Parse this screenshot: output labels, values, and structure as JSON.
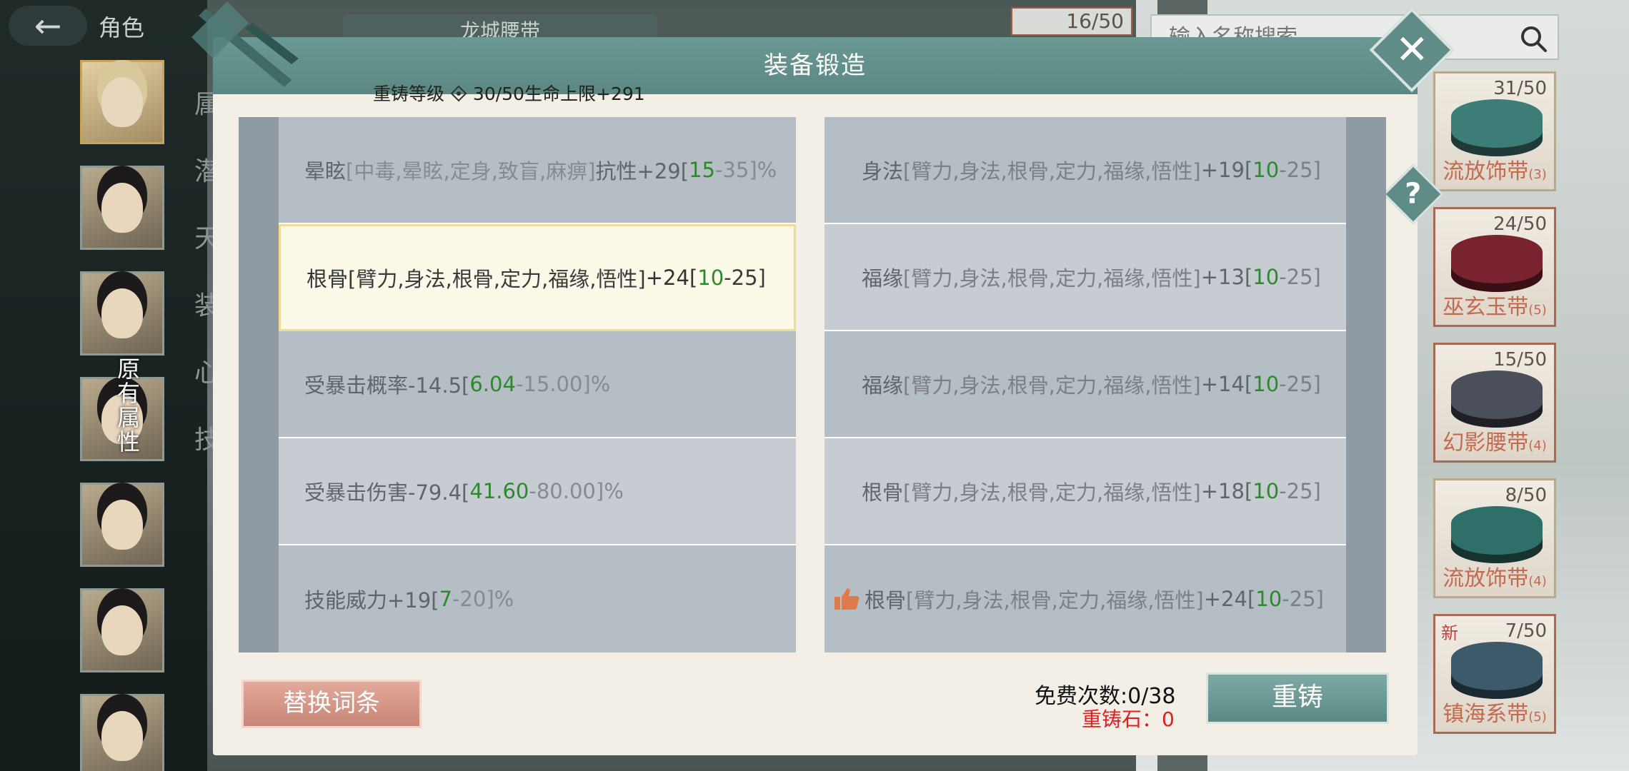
{
  "topbar": {
    "title": "角色",
    "back_icon": "back-arrow-icon"
  },
  "background": {
    "tab_label": "龙城腰带",
    "side_menu": [
      "属",
      "潜",
      "天",
      "装",
      "心",
      "技"
    ],
    "top_count": "16/50",
    "original_attr_label": "原有属性"
  },
  "search": {
    "placeholder": "输入名称搜索"
  },
  "items": [
    {
      "count": "31/50",
      "name": "流放饰带",
      "qty": "(3)",
      "color": "#3d7d78"
    },
    {
      "count": "24/50",
      "name": "巫玄玉带",
      "qty": "(5)",
      "color": "#7a2330"
    },
    {
      "count": "15/50",
      "name": "幻影腰带",
      "qty": "(4)",
      "color": "#4b4f5a"
    },
    {
      "count": "8/50",
      "name": "流放饰带",
      "qty": "(4)",
      "color": "#2f6f6a"
    },
    {
      "count": "7/50",
      "name": "镇海系带",
      "qty": "(5)",
      "color": "#3c5a6a",
      "badge": "新"
    }
  ],
  "modal": {
    "title": "装备锻造",
    "reforge_level": "重铸等级",
    "reforge_level_value": "30/50生命上限+291",
    "left_rows": [
      {
        "name": "晕眩",
        "scope": "[中毒,晕眩,定身,致盲,麻痹]",
        "suffix": "抗性+29[",
        "low": "15",
        "high": "-35]%"
      },
      {
        "name": "根骨",
        "scope": "[臂力,身法,根骨,定力,福缘,悟性]",
        "suffix": "+24[",
        "low": "10",
        "high": "-25]",
        "selected": true
      },
      {
        "name": "受暴击概率-14.5[",
        "scope": "",
        "suffix": "",
        "low": "6.04",
        "high": "-15.00]%"
      },
      {
        "name": "受暴击伤害-79.4[",
        "scope": "",
        "suffix": "",
        "low": "41.60",
        "high": "-80.00]%"
      },
      {
        "name": "技能威力+19[",
        "scope": "",
        "suffix": "",
        "low": "7",
        "high": "-20]%"
      }
    ],
    "right_rows": [
      {
        "name": "身法",
        "scope": "[臂力,身法,根骨,定力,福缘,悟性]",
        "suffix": "+19[",
        "low": "10",
        "high": "-25]"
      },
      {
        "name": "福缘",
        "scope": "[臂力,身法,根骨,定力,福缘,悟性]",
        "suffix": "+13[",
        "low": "10",
        "high": "-25]"
      },
      {
        "name": "福缘",
        "scope": "[臂力,身法,根骨,定力,福缘,悟性]",
        "suffix": "+14[",
        "low": "10",
        "high": "-25]"
      },
      {
        "name": "根骨",
        "scope": "[臂力,身法,根骨,定力,福缘,悟性]",
        "suffix": "+18[",
        "low": "10",
        "high": "-25]"
      },
      {
        "name": "根骨",
        "scope": "[臂力,身法,根骨,定力,福缘,悟性]",
        "suffix": "+24[",
        "low": "10",
        "high": "-25]",
        "recommended": true
      }
    ],
    "replace_label": "替换词条",
    "free_count": "免费次数:0/38",
    "stone_count": "重铸石：0",
    "reforge_label": "重铸",
    "colors": {
      "header": "#5c8883",
      "green_value": "#2c8a2c",
      "stone_red": "#e02020",
      "replace_btn": "#c88676"
    }
  }
}
